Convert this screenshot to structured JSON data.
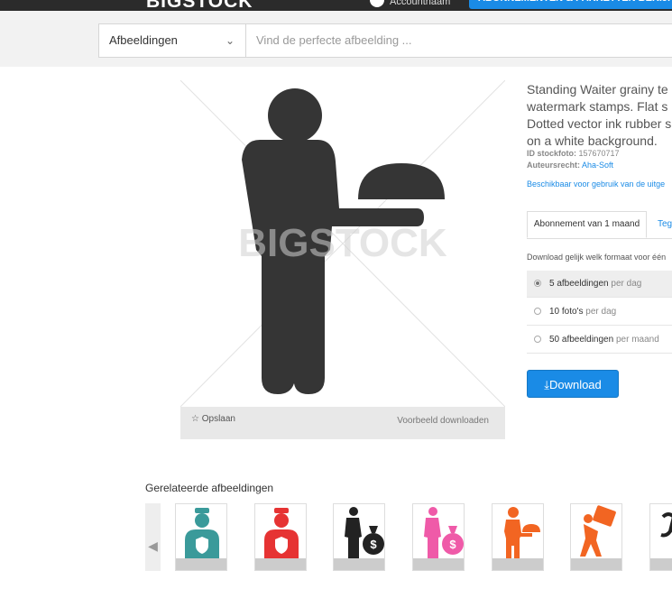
{
  "header": {
    "logo": "BIGSTOCK",
    "user_name": "Accountnaam",
    "cta_label": "ABONNEMENTEN & PAKKETTEN BEKIJKEN"
  },
  "search": {
    "category": "Afbeeldingen",
    "placeholder": "Vind de perfecte afbeelding ..."
  },
  "image": {
    "watermark": "BIGSTOCK",
    "save_label": "Opslaan",
    "preview_label": "Voorbeeld downloaden"
  },
  "details": {
    "title_lines": [
      "Standing Waiter grainy te",
      "watermark stamps. Flat s",
      "Dotted vector ink rubber s",
      "on a white background."
    ],
    "id_label": "ID stockfoto:",
    "id_value": "157670717",
    "copyright_label": "Auteursrecht:",
    "copyright_value": "Aha-Soft",
    "availability": "Beschikbaar voor gebruik van de uitge"
  },
  "tabs": {
    "active": "Abonnement van 1 maand",
    "other": "Teg"
  },
  "download": {
    "intro": "Download gelijk welk formaat voor één",
    "options": [
      {
        "label": "5 afbeeldingen",
        "unit": "per dag"
      },
      {
        "label": "10 foto's",
        "unit": "per dag"
      },
      {
        "label": "50 afbeeldingen",
        "unit": "per maand"
      }
    ],
    "button_label": "Download"
  },
  "related": {
    "heading": "Gerelateerde afbeeldingen"
  },
  "colors": {
    "accent": "#1a8be6",
    "dark": "#2b2b2b",
    "thumb_teal": "#3a9a9a",
    "thumb_red": "#e63333",
    "thumb_pink": "#ef5aa8",
    "thumb_orange": "#f26522"
  }
}
